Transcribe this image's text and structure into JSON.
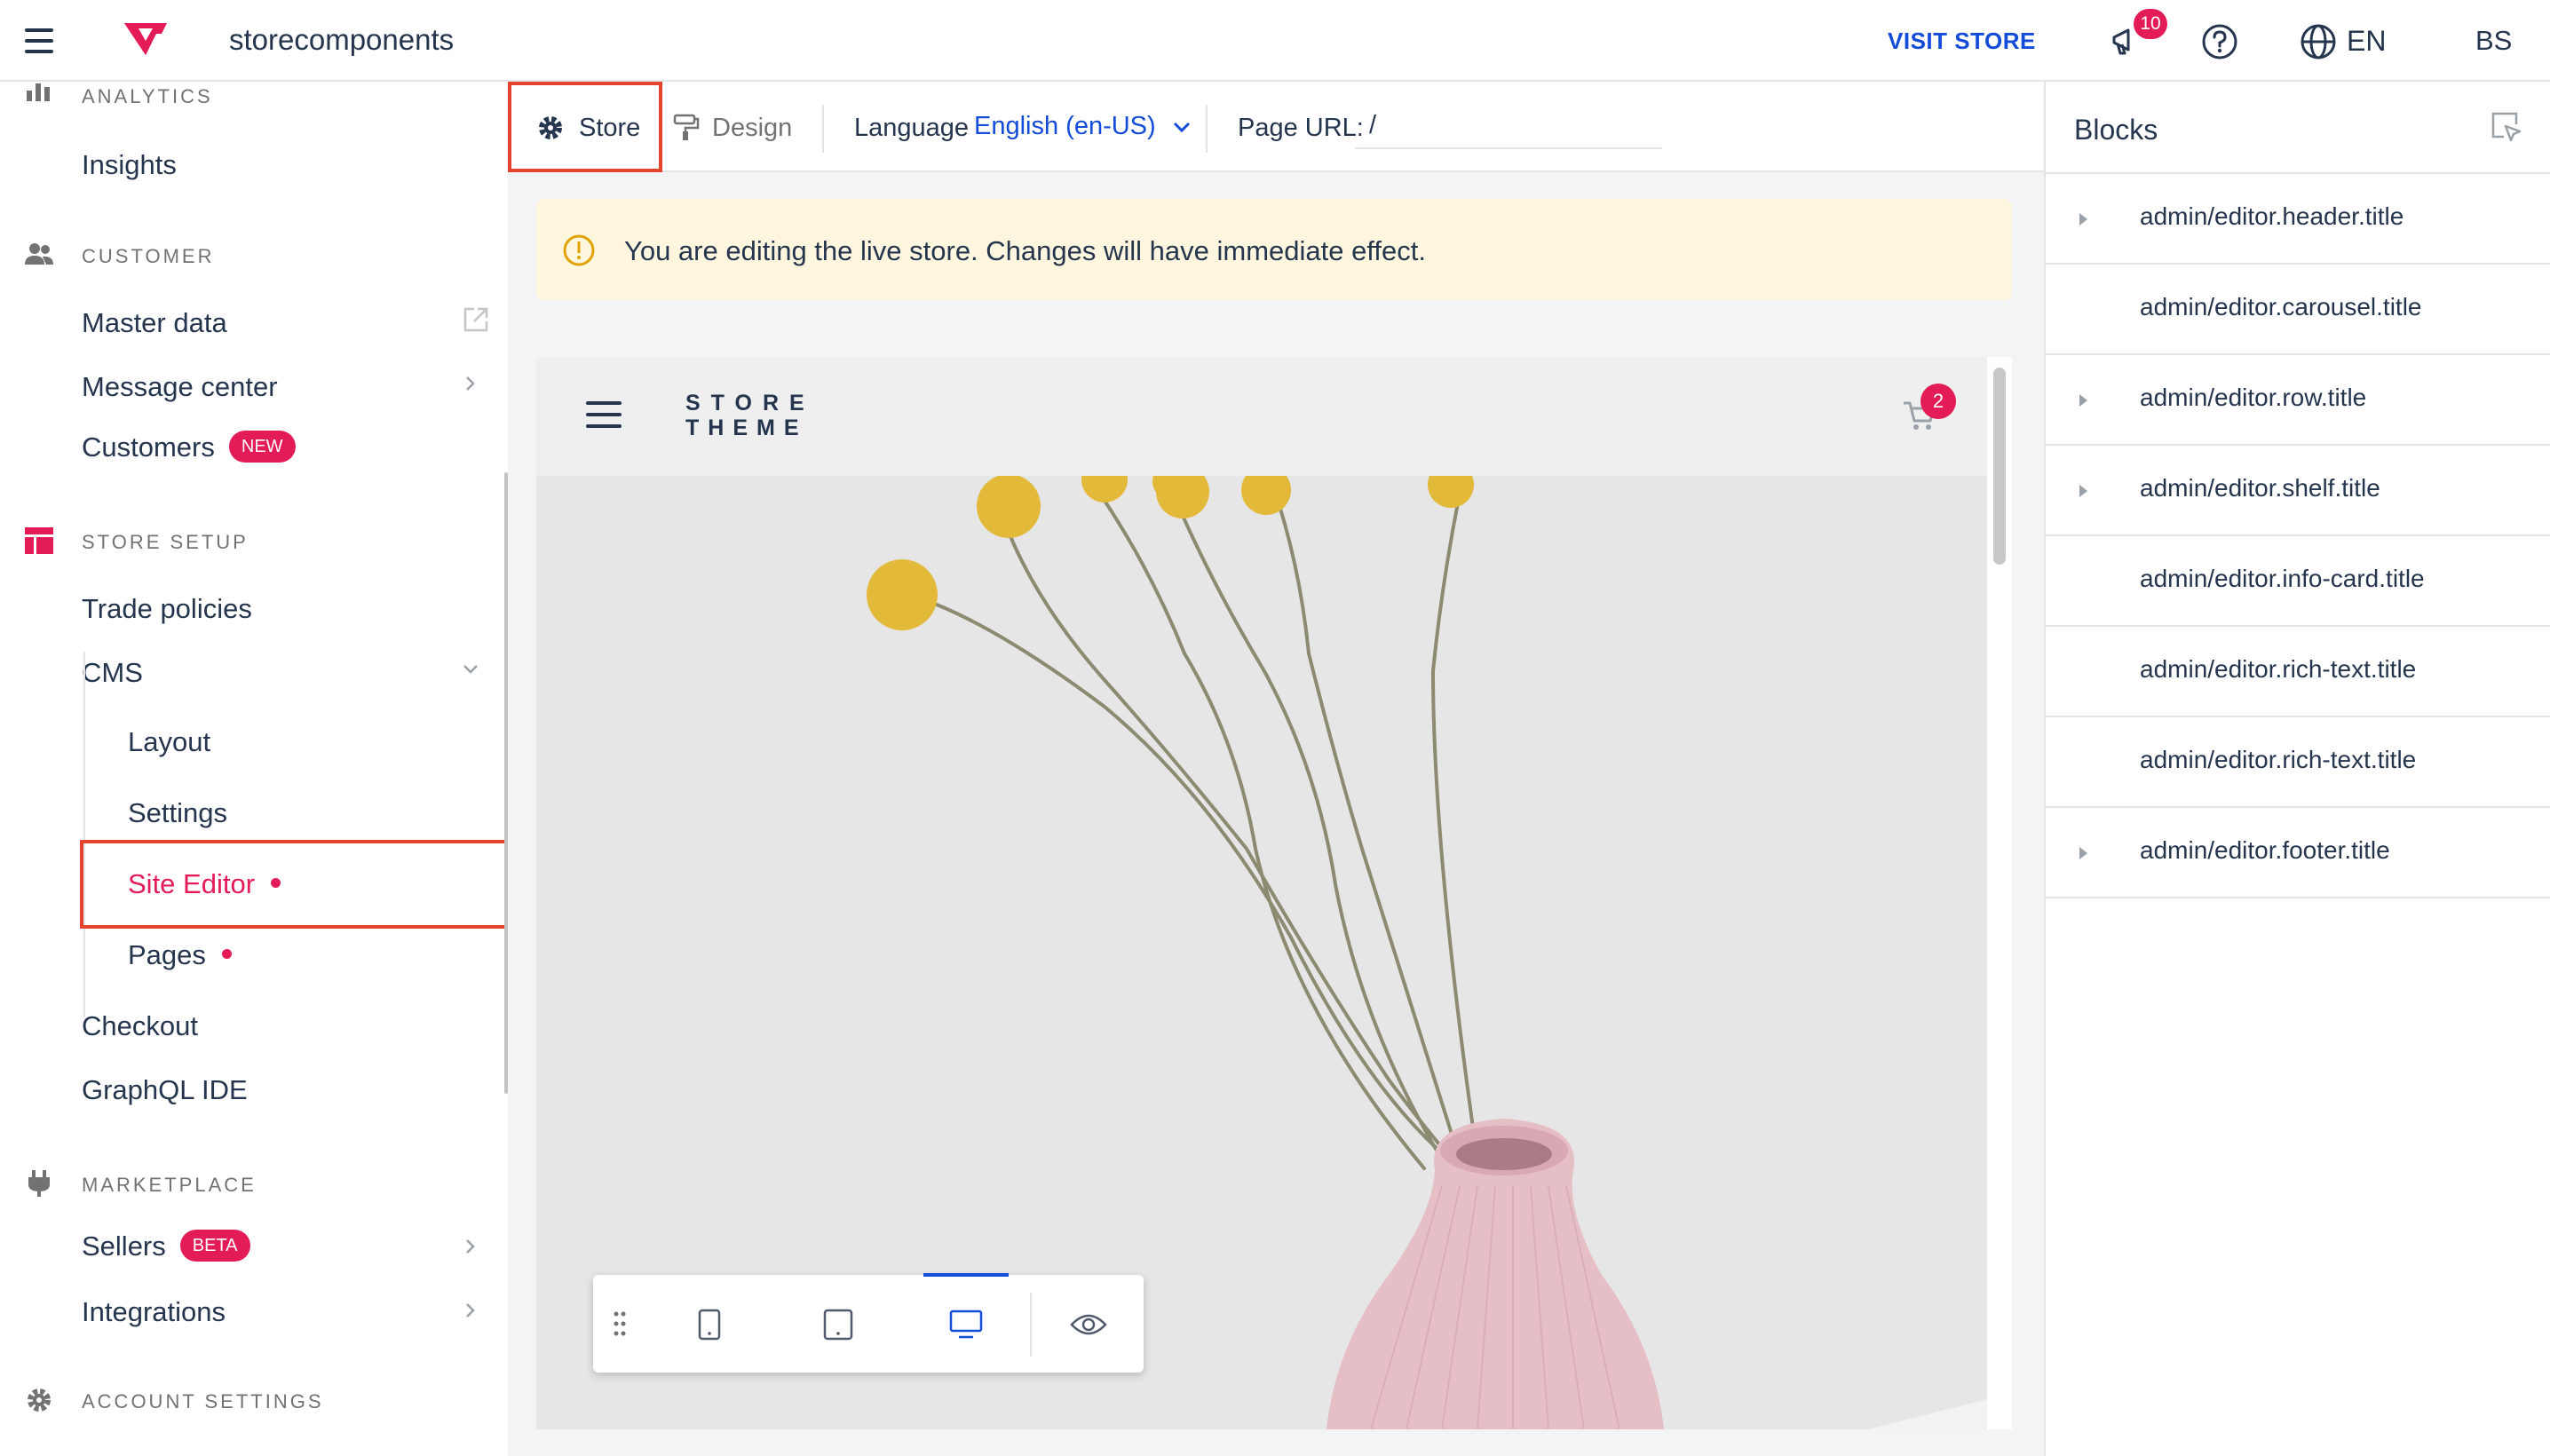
{
  "topbar": {
    "account_name": "storecomponents",
    "visit_store": "VISIT STORE",
    "notification_count": "10",
    "language": "EN",
    "user_initials": "BS",
    "brand_color": "#e31c58",
    "link_color": "#134cd8"
  },
  "sidebar": {
    "analytics": {
      "label": "ANALYTICS",
      "icon": "bar-chart-icon",
      "items": [
        {
          "label": "Insights"
        }
      ]
    },
    "customer": {
      "label": "CUSTOMER",
      "icon": "users-icon",
      "items": [
        {
          "label": "Master data",
          "icon": "external-link-icon"
        },
        {
          "label": "Message center"
        },
        {
          "label": "Customers",
          "badge": "NEW"
        }
      ]
    },
    "store_setup": {
      "label": "STORE SETUP",
      "icon": "store-layout-icon",
      "items": [
        {
          "label": "Trade policies"
        },
        {
          "label": "CMS"
        },
        {
          "label": "Checkout"
        },
        {
          "label": "GraphQL IDE"
        }
      ],
      "cms_children": [
        {
          "label": "Layout"
        },
        {
          "label": "Settings"
        },
        {
          "label": "Site Editor",
          "active": true
        },
        {
          "label": "Pages"
        }
      ]
    },
    "marketplace": {
      "label": "MARKETPLACE",
      "icon": "plug-icon",
      "items": [
        {
          "label": "Sellers",
          "badge": "BETA"
        },
        {
          "label": "Integrations"
        }
      ]
    },
    "account_settings": {
      "label": "ACCOUNT SETTINGS",
      "icon": "gear-icon"
    }
  },
  "toolbar": {
    "store_tab": "Store",
    "design_tab": "Design",
    "language_label": "Language",
    "language_value": "English (en-US)",
    "page_url_label": "Page URL:",
    "page_url_value": "/"
  },
  "warning": {
    "text": "You are editing the live store. Changes will have immediate effect."
  },
  "preview": {
    "logo_line1": "STORE",
    "logo_line2": "THEME",
    "cart_count": "2",
    "hero_alt": "pink vase with dried yellow flowers"
  },
  "device_bar": {
    "buttons": [
      "drag-handle-icon",
      "mobile-icon",
      "tablet-icon",
      "desktop-icon",
      "preview-eye-icon"
    ],
    "active": "desktop-icon"
  },
  "blocks": {
    "title": "Blocks",
    "items": [
      {
        "label": "admin/editor.header.title",
        "expandable": true
      },
      {
        "label": "admin/editor.carousel.title",
        "expandable": false
      },
      {
        "label": "admin/editor.row.title",
        "expandable": true
      },
      {
        "label": "admin/editor.shelf.title",
        "expandable": true
      },
      {
        "label": "admin/editor.info-card.title",
        "expandable": false
      },
      {
        "label": "admin/editor.rich-text.title",
        "expandable": false
      },
      {
        "label": "admin/editor.rich-text.title",
        "expandable": false
      },
      {
        "label": "admin/editor.footer.title",
        "expandable": true
      }
    ]
  }
}
